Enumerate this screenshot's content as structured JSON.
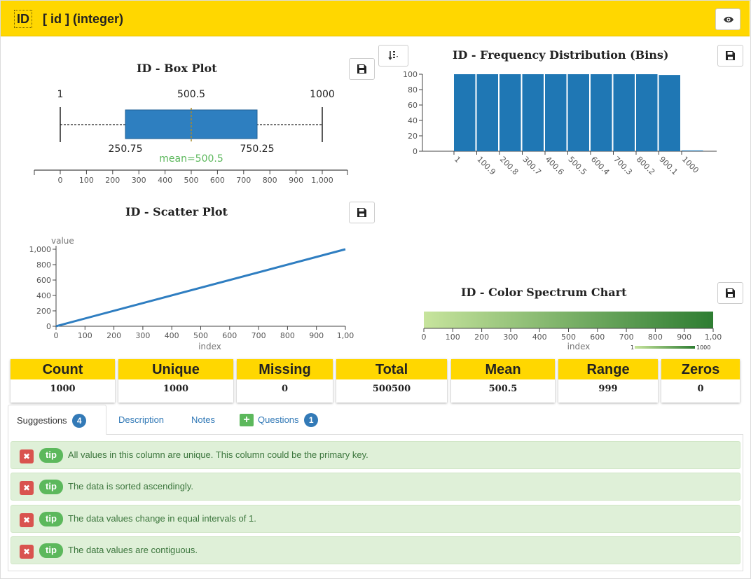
{
  "header": {
    "id_badge": "ID",
    "column_title": "[ id ] (integer)",
    "eye_icon": "eye-icon"
  },
  "box_plot": {
    "title": "ID - Box Plot",
    "min_label": "1",
    "median_label": "500.5",
    "max_label": "1000",
    "q1_label": "250.75",
    "q3_label": "750.25",
    "mean_label": "mean=500.5",
    "axis_ticks": [
      "0",
      "100",
      "200",
      "300",
      "400",
      "500",
      "600",
      "700",
      "800",
      "900",
      "1,000"
    ]
  },
  "histogram": {
    "title": "ID - Frequency Distribution (Bins)",
    "sort_icon": "sort-icon"
  },
  "scatter": {
    "title": "ID - Scatter Plot",
    "y_label": "value",
    "x_label": "index"
  },
  "spectrum": {
    "title": "ID - Color Spectrum Chart",
    "x_label": "index",
    "legend_min": "1",
    "legend_max": "1000",
    "ticks": [
      "0",
      "100",
      "200",
      "300",
      "400",
      "500",
      "600",
      "700",
      "800",
      "900",
      "1,00"
    ]
  },
  "stats": [
    {
      "label": "Count",
      "value": "1000"
    },
    {
      "label": "Unique",
      "value": "1000"
    },
    {
      "label": "Missing",
      "value": "0"
    },
    {
      "label": "Total",
      "value": "500500"
    },
    {
      "label": "Mean",
      "value": "500.5"
    },
    {
      "label": "Range",
      "value": "999"
    },
    {
      "label": "Zeros",
      "value": "0"
    }
  ],
  "tabs": [
    {
      "label": "Suggestions",
      "badge": "4"
    },
    {
      "label": "Description"
    },
    {
      "label": "Notes"
    },
    {
      "label": "Questions",
      "badge": "1"
    }
  ],
  "suggestions": [
    {
      "badge": "tip",
      "text": "All values in this column are unique. This column could be the primary key."
    },
    {
      "badge": "tip",
      "text": "The data is sorted ascendingly."
    },
    {
      "badge": "tip",
      "text": "The data values change in equal intervals of 1."
    },
    {
      "badge": "tip",
      "text": "The data values are contiguous."
    }
  ],
  "colors": {
    "header": "#ffd700",
    "bar": "#1f77b4",
    "spectrum_start": "#c7e49d",
    "spectrum_end": "#2e7d32",
    "tip_green": "#5cb85c",
    "dismiss_red": "#d9534f"
  },
  "chart_data": [
    {
      "type": "box",
      "title": "ID - Box Plot",
      "min": 1,
      "q1": 250.75,
      "median": 500.5,
      "q3": 750.25,
      "max": 1000,
      "mean": 500.5,
      "xlim": [
        0,
        1000
      ]
    },
    {
      "type": "bar",
      "title": "ID - Frequency Distribution (Bins)",
      "categories": [
        "1",
        "100.9",
        "200.8",
        "300.7",
        "400.6",
        "500.5",
        "600.4",
        "700.3",
        "800.2",
        "900.1",
        "1000"
      ],
      "values": [
        100,
        100,
        100,
        100,
        100,
        100,
        100,
        100,
        100,
        99,
        1
      ],
      "yticks": [
        "0",
        "20",
        "40",
        "60",
        "80",
        "100"
      ],
      "ylim": [
        0,
        100
      ]
    },
    {
      "type": "scatter",
      "title": "ID - Scatter Plot",
      "xlabel": "index",
      "ylabel": "value",
      "x": [
        0,
        1000
      ],
      "y": [
        1,
        1000
      ],
      "xlim": [
        0,
        1000
      ],
      "ylim": [
        0,
        1000
      ],
      "xticks": [
        "0",
        "100",
        "200",
        "300",
        "400",
        "500",
        "600",
        "700",
        "800",
        "900",
        "1,00"
      ],
      "yticks": [
        "0",
        "200",
        "400",
        "600",
        "800",
        "1,000"
      ]
    },
    {
      "type": "heatmap",
      "title": "ID - Color Spectrum Chart",
      "xlabel": "index",
      "xlim": [
        0,
        1000
      ],
      "value_range": [
        1,
        1000
      ]
    }
  ]
}
